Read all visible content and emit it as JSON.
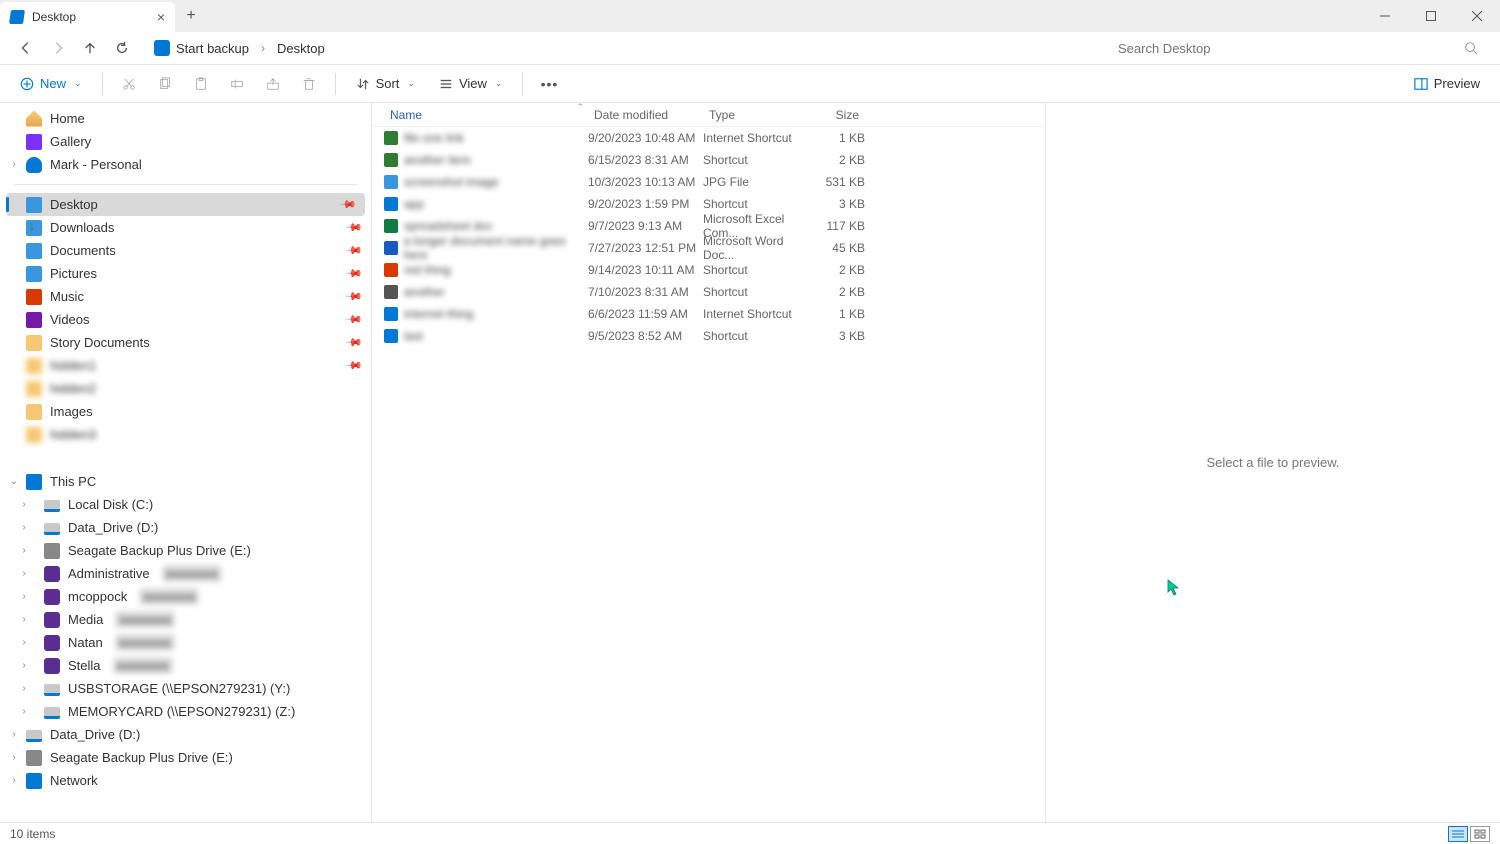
{
  "window": {
    "tab_title": "Desktop"
  },
  "breadcrumb": {
    "segments": [
      {
        "label": "Start backup",
        "has_icon": true
      },
      {
        "label": "Desktop"
      }
    ]
  },
  "search": {
    "placeholder": "Search Desktop"
  },
  "toolbar": {
    "new_label": "New",
    "sort_label": "Sort",
    "view_label": "View",
    "preview_label": "Preview"
  },
  "sidebar": {
    "top": [
      {
        "label": "Home",
        "icon": "ic-home"
      },
      {
        "label": "Gallery",
        "icon": "ic-gallery"
      },
      {
        "label": "Mark - Personal",
        "icon": "ic-cloud",
        "expand": "›"
      }
    ],
    "quick": [
      {
        "label": "Desktop",
        "icon": "ic-blue",
        "active": true,
        "pin": true
      },
      {
        "label": "Downloads",
        "icon": "ic-down",
        "pin": true
      },
      {
        "label": "Documents",
        "icon": "ic-doc",
        "pin": true
      },
      {
        "label": "Pictures",
        "icon": "ic-pic",
        "pin": true
      },
      {
        "label": "Music",
        "icon": "ic-music",
        "pin": true
      },
      {
        "label": "Videos",
        "icon": "ic-video",
        "pin": true
      },
      {
        "label": "Story Documents",
        "icon": "ic-folder",
        "pin": true
      },
      {
        "label": "hidden1",
        "icon": "ic-folder",
        "pin": true,
        "blurred": true
      },
      {
        "label": "hidden2",
        "icon": "ic-folder",
        "blurred": true
      },
      {
        "label": "Images",
        "icon": "ic-folder"
      },
      {
        "label": "hidden3",
        "icon": "ic-folder",
        "blurred": true
      }
    ],
    "thispc": {
      "label": "This PC",
      "expand": "⌄"
    },
    "drives": [
      {
        "label": "Local Disk (C:)",
        "icon": "ic-disk"
      },
      {
        "label": "Data_Drive (D:)",
        "icon": "ic-disk"
      },
      {
        "label": "Seagate Backup Plus Drive (E:)",
        "icon": "ic-ext"
      },
      {
        "label": "Administrative",
        "icon": "ic-net",
        "blur_tail": true
      },
      {
        "label": "mcoppock",
        "icon": "ic-net",
        "blur_tail": true
      },
      {
        "label": "Media",
        "icon": "ic-net",
        "blur_tail": true
      },
      {
        "label": "Natan",
        "icon": "ic-net",
        "blur_tail": true
      },
      {
        "label": "Stella",
        "icon": "ic-net",
        "blur_tail": true
      },
      {
        "label": "USBSTORAGE (\\\\EPSON279231) (Y:)",
        "icon": "ic-disk"
      },
      {
        "label": "MEMORYCARD (\\\\EPSON279231) (Z:)",
        "icon": "ic-disk"
      }
    ],
    "bottom": [
      {
        "label": "Data_Drive (D:)",
        "icon": "ic-disk"
      },
      {
        "label": "Seagate Backup Plus Drive (E:)",
        "icon": "ic-ext"
      },
      {
        "label": "Network",
        "icon": "ic-pc"
      }
    ]
  },
  "columns": {
    "name": "Name",
    "date": "Date modified",
    "type": "Type",
    "size": "Size"
  },
  "files": [
    {
      "name": "file one link",
      "color": "#2e7d32",
      "date": "9/20/2023 10:48 AM",
      "type": "Internet Shortcut",
      "size": "1 KB"
    },
    {
      "name": "another item",
      "color": "#2e7d32",
      "date": "6/15/2023 8:31 AM",
      "type": "Shortcut",
      "size": "2 KB"
    },
    {
      "name": "screenshot image",
      "color": "#3a96dd",
      "date": "10/3/2023 10:13 AM",
      "type": "JPG File",
      "size": "531 KB"
    },
    {
      "name": "app",
      "color": "#0078d4",
      "date": "9/20/2023 1:59 PM",
      "type": "Shortcut",
      "size": "3 KB"
    },
    {
      "name": "spreadsheet doc",
      "color": "#107c41",
      "date": "9/7/2023 9:13 AM",
      "type": "Microsoft Excel Com...",
      "size": "117 KB"
    },
    {
      "name": "a longer document name goes here",
      "color": "#185abd",
      "date": "7/27/2023 12:51 PM",
      "type": "Microsoft Word Doc...",
      "size": "45 KB"
    },
    {
      "name": "red thing",
      "color": "#d83b01",
      "date": "9/14/2023 10:11 AM",
      "type": "Shortcut",
      "size": "2 KB"
    },
    {
      "name": "another",
      "color": "#555555",
      "date": "7/10/2023 8:31 AM",
      "type": "Shortcut",
      "size": "2 KB"
    },
    {
      "name": "internet thing",
      "color": "#0078d4",
      "date": "6/6/2023 11:59 AM",
      "type": "Internet Shortcut",
      "size": "1 KB"
    },
    {
      "name": "last",
      "color": "#0078d4",
      "date": "9/5/2023 8:52 AM",
      "type": "Shortcut",
      "size": "3 KB"
    }
  ],
  "preview": {
    "empty_text": "Select a file to preview."
  },
  "status": {
    "count_text": "10 items"
  }
}
